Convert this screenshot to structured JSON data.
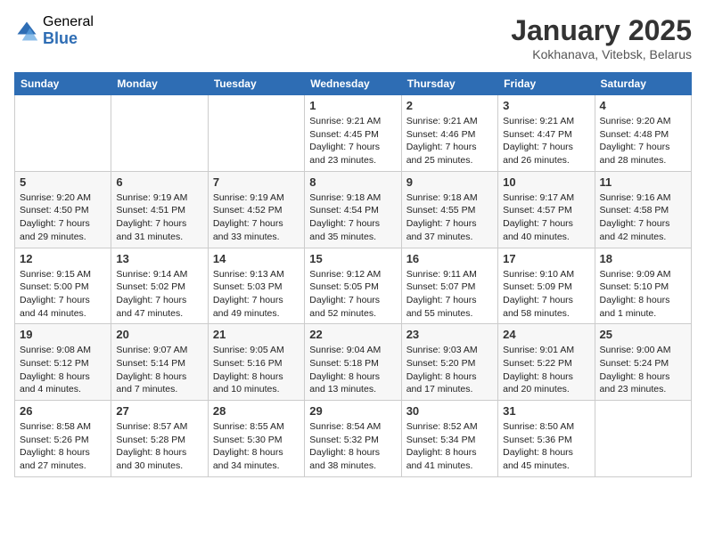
{
  "logo": {
    "general": "General",
    "blue": "Blue"
  },
  "title": "January 2025",
  "location": "Kokhanava, Vitebsk, Belarus",
  "days_header": [
    "Sunday",
    "Monday",
    "Tuesday",
    "Wednesday",
    "Thursday",
    "Friday",
    "Saturday"
  ],
  "weeks": [
    [
      {
        "day": "",
        "info": ""
      },
      {
        "day": "",
        "info": ""
      },
      {
        "day": "",
        "info": ""
      },
      {
        "day": "1",
        "info": "Sunrise: 9:21 AM\nSunset: 4:45 PM\nDaylight: 7 hours\nand 23 minutes."
      },
      {
        "day": "2",
        "info": "Sunrise: 9:21 AM\nSunset: 4:46 PM\nDaylight: 7 hours\nand 25 minutes."
      },
      {
        "day": "3",
        "info": "Sunrise: 9:21 AM\nSunset: 4:47 PM\nDaylight: 7 hours\nand 26 minutes."
      },
      {
        "day": "4",
        "info": "Sunrise: 9:20 AM\nSunset: 4:48 PM\nDaylight: 7 hours\nand 28 minutes."
      }
    ],
    [
      {
        "day": "5",
        "info": "Sunrise: 9:20 AM\nSunset: 4:50 PM\nDaylight: 7 hours\nand 29 minutes."
      },
      {
        "day": "6",
        "info": "Sunrise: 9:19 AM\nSunset: 4:51 PM\nDaylight: 7 hours\nand 31 minutes."
      },
      {
        "day": "7",
        "info": "Sunrise: 9:19 AM\nSunset: 4:52 PM\nDaylight: 7 hours\nand 33 minutes."
      },
      {
        "day": "8",
        "info": "Sunrise: 9:18 AM\nSunset: 4:54 PM\nDaylight: 7 hours\nand 35 minutes."
      },
      {
        "day": "9",
        "info": "Sunrise: 9:18 AM\nSunset: 4:55 PM\nDaylight: 7 hours\nand 37 minutes."
      },
      {
        "day": "10",
        "info": "Sunrise: 9:17 AM\nSunset: 4:57 PM\nDaylight: 7 hours\nand 40 minutes."
      },
      {
        "day": "11",
        "info": "Sunrise: 9:16 AM\nSunset: 4:58 PM\nDaylight: 7 hours\nand 42 minutes."
      }
    ],
    [
      {
        "day": "12",
        "info": "Sunrise: 9:15 AM\nSunset: 5:00 PM\nDaylight: 7 hours\nand 44 minutes."
      },
      {
        "day": "13",
        "info": "Sunrise: 9:14 AM\nSunset: 5:02 PM\nDaylight: 7 hours\nand 47 minutes."
      },
      {
        "day": "14",
        "info": "Sunrise: 9:13 AM\nSunset: 5:03 PM\nDaylight: 7 hours\nand 49 minutes."
      },
      {
        "day": "15",
        "info": "Sunrise: 9:12 AM\nSunset: 5:05 PM\nDaylight: 7 hours\nand 52 minutes."
      },
      {
        "day": "16",
        "info": "Sunrise: 9:11 AM\nSunset: 5:07 PM\nDaylight: 7 hours\nand 55 minutes."
      },
      {
        "day": "17",
        "info": "Sunrise: 9:10 AM\nSunset: 5:09 PM\nDaylight: 7 hours\nand 58 minutes."
      },
      {
        "day": "18",
        "info": "Sunrise: 9:09 AM\nSunset: 5:10 PM\nDaylight: 8 hours\nand 1 minute."
      }
    ],
    [
      {
        "day": "19",
        "info": "Sunrise: 9:08 AM\nSunset: 5:12 PM\nDaylight: 8 hours\nand 4 minutes."
      },
      {
        "day": "20",
        "info": "Sunrise: 9:07 AM\nSunset: 5:14 PM\nDaylight: 8 hours\nand 7 minutes."
      },
      {
        "day": "21",
        "info": "Sunrise: 9:05 AM\nSunset: 5:16 PM\nDaylight: 8 hours\nand 10 minutes."
      },
      {
        "day": "22",
        "info": "Sunrise: 9:04 AM\nSunset: 5:18 PM\nDaylight: 8 hours\nand 13 minutes."
      },
      {
        "day": "23",
        "info": "Sunrise: 9:03 AM\nSunset: 5:20 PM\nDaylight: 8 hours\nand 17 minutes."
      },
      {
        "day": "24",
        "info": "Sunrise: 9:01 AM\nSunset: 5:22 PM\nDaylight: 8 hours\nand 20 minutes."
      },
      {
        "day": "25",
        "info": "Sunrise: 9:00 AM\nSunset: 5:24 PM\nDaylight: 8 hours\nand 23 minutes."
      }
    ],
    [
      {
        "day": "26",
        "info": "Sunrise: 8:58 AM\nSunset: 5:26 PM\nDaylight: 8 hours\nand 27 minutes."
      },
      {
        "day": "27",
        "info": "Sunrise: 8:57 AM\nSunset: 5:28 PM\nDaylight: 8 hours\nand 30 minutes."
      },
      {
        "day": "28",
        "info": "Sunrise: 8:55 AM\nSunset: 5:30 PM\nDaylight: 8 hours\nand 34 minutes."
      },
      {
        "day": "29",
        "info": "Sunrise: 8:54 AM\nSunset: 5:32 PM\nDaylight: 8 hours\nand 38 minutes."
      },
      {
        "day": "30",
        "info": "Sunrise: 8:52 AM\nSunset: 5:34 PM\nDaylight: 8 hours\nand 41 minutes."
      },
      {
        "day": "31",
        "info": "Sunrise: 8:50 AM\nSunset: 5:36 PM\nDaylight: 8 hours\nand 45 minutes."
      },
      {
        "day": "",
        "info": ""
      }
    ]
  ]
}
